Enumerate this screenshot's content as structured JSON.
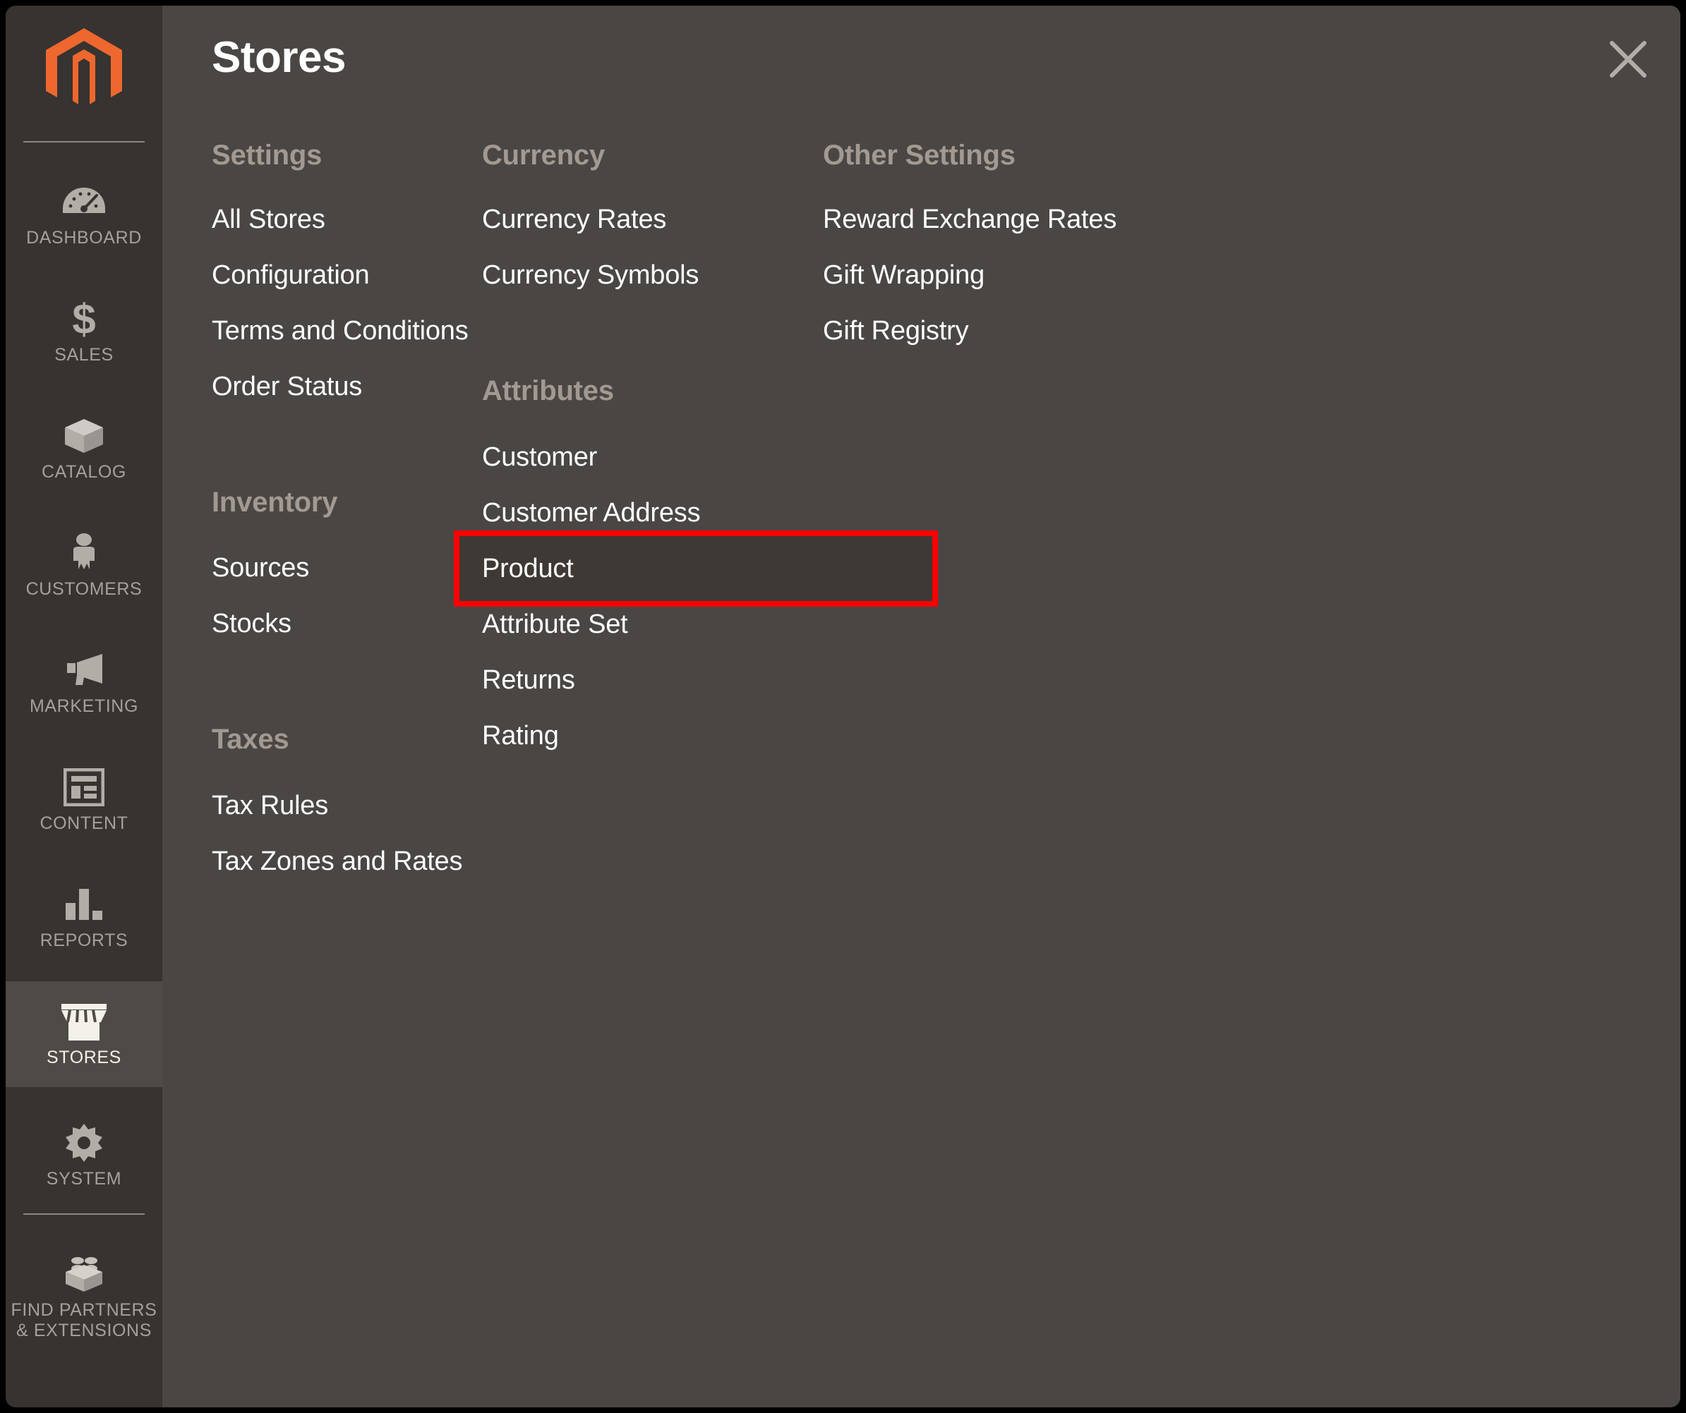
{
  "sidebar": {
    "logo_name": "magento-logo",
    "items": [
      {
        "label": "DASHBOARD",
        "icon": "dashboard-gauge-icon",
        "active": false
      },
      {
        "label": "SALES",
        "icon": "dollar-sign-icon",
        "active": false
      },
      {
        "label": "CATALOG",
        "icon": "box-icon",
        "active": false
      },
      {
        "label": "CUSTOMERS",
        "icon": "person-icon",
        "active": false
      },
      {
        "label": "MARKETING",
        "icon": "megaphone-icon",
        "active": false
      },
      {
        "label": "CONTENT",
        "icon": "layout-page-icon",
        "active": false
      },
      {
        "label": "REPORTS",
        "icon": "bar-chart-icon",
        "active": false
      },
      {
        "label": "STORES",
        "icon": "storefront-icon",
        "active": true
      },
      {
        "label": "SYSTEM",
        "icon": "gear-icon",
        "active": false
      },
      {
        "label": "FIND PARTNERS\n& EXTENSIONS",
        "icon": "lego-brick-icon",
        "active": false
      }
    ]
  },
  "panel": {
    "title": "Stores",
    "close_icon": "close-x-icon",
    "groups": [
      {
        "id": "settings",
        "title": "Settings",
        "items": [
          "All Stores",
          "Configuration",
          "Terms and Conditions",
          "Order Status"
        ]
      },
      {
        "id": "inventory",
        "title": "Inventory",
        "items": [
          "Sources",
          "Stocks"
        ]
      },
      {
        "id": "taxes",
        "title": "Taxes",
        "items": [
          "Tax Rules",
          "Tax Zones and Rates"
        ]
      },
      {
        "id": "currency",
        "title": "Currency",
        "items": [
          "Currency Rates",
          "Currency Symbols"
        ]
      },
      {
        "id": "attributes",
        "title": "Attributes",
        "items": [
          "Customer",
          "Customer Address",
          "Product",
          "Attribute Set",
          "Returns",
          "Rating"
        ]
      },
      {
        "id": "other_settings",
        "title": "Other Settings",
        "items": [
          "Reward Exchange Rates",
          "Gift Wrapping",
          "Gift Registry"
        ]
      }
    ],
    "highlighted_item": "Product"
  },
  "colors": {
    "sidebar_bg": "#373330",
    "panel_bg": "#4a4643",
    "sidebar_active_bg": "#4e4a46",
    "brand_orange": "#ee672e",
    "group_title": "#a29992",
    "link_text": "#ffffff",
    "highlight_border": "#ff0000",
    "highlight_fill": "#3e3934"
  }
}
